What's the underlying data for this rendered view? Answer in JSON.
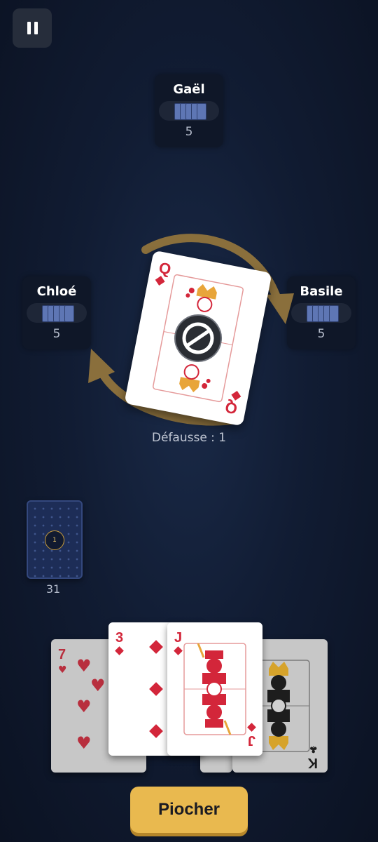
{
  "players": [
    {
      "name": "Gaël",
      "card_count": "5"
    },
    {
      "name": "Chloé",
      "card_count": "5"
    },
    {
      "name": "Basile",
      "card_count": "5"
    }
  ],
  "discard": {
    "label": "Défausse : 1",
    "top_card": {
      "rank": "Q",
      "suit": "diamonds",
      "action_icon": "skip-icon"
    }
  },
  "deck": {
    "count": "31",
    "badge": "1"
  },
  "hand": [
    {
      "rank": "7",
      "suit": "hearts"
    },
    {
      "rank": "3",
      "suit": "diamonds"
    },
    {
      "rank": "J",
      "suit": "diamonds"
    },
    {
      "rank": "K",
      "suit": "clubs"
    }
  ],
  "actions": {
    "draw_label": "Piocher"
  },
  "colors": {
    "red": "#d3263a",
    "gold": "#e9b94f",
    "arrow": "#8a6f3c"
  }
}
